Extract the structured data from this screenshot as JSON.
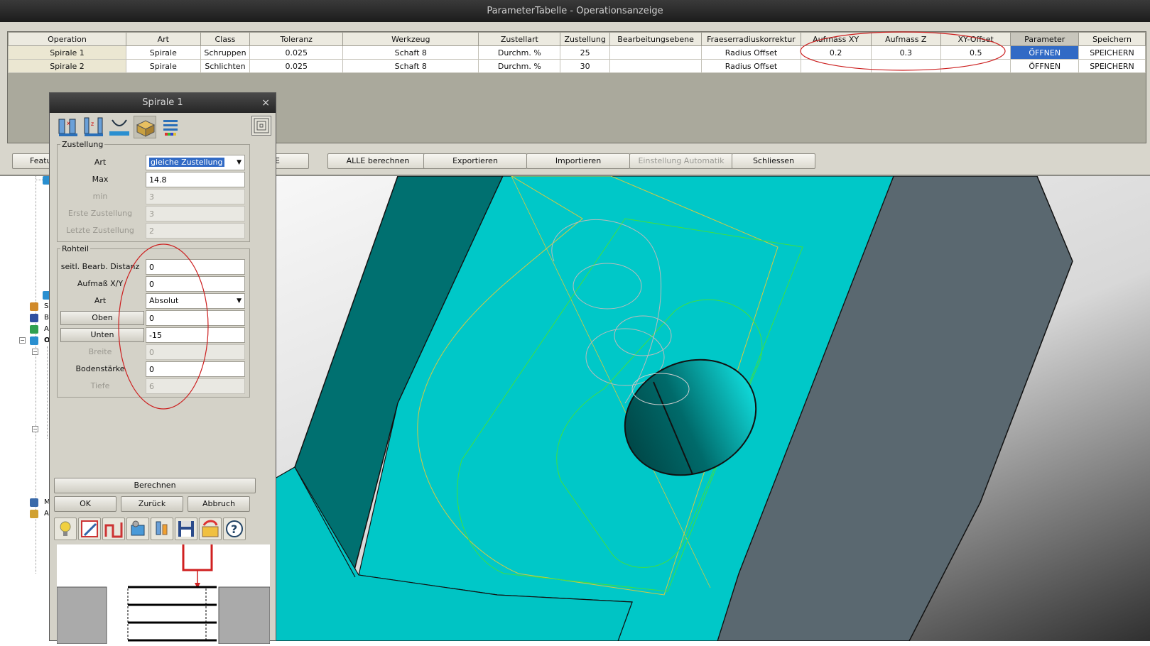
{
  "param_window": {
    "title": "ParameterTabelle - Operationsanzeige",
    "columns": [
      "Operation",
      "Art",
      "Class",
      "Toleranz",
      "Werkzeug",
      "Zustellart",
      "Zustellung",
      "Bearbeitungsebene",
      "Fraeserradiuskorrektur",
      "Aufmass XY",
      "Aufmass Z",
      "XY-Offset",
      "Parameter",
      "Speichern"
    ],
    "rows": [
      [
        "Spirale 1",
        "Spirale",
        "Schruppen",
        "0.025",
        "Schaft 8",
        "Durchm. %",
        "25",
        "",
        "Radius Offset",
        "0.2",
        "0.3",
        "0.5",
        "ÖFFNEN",
        "SPEICHERN"
      ],
      [
        "Spirale 2",
        "Spirale",
        "Schlichten",
        "0.025",
        "Schaft 8",
        "Durchm. %",
        "30",
        "",
        "Radius Offset",
        "",
        "",
        "",
        "ÖFFNEN",
        "SPEICHERN"
      ]
    ],
    "buttons": {
      "features": "Featu",
      "alle": "ALLE",
      "alle_berechnen": "ALLE berechnen",
      "exportieren": "Exportieren",
      "importieren": "Importieren",
      "einstellung_automatik": "Einstellung Automatik",
      "schliessen": "Schliessen"
    }
  },
  "dialog": {
    "title": "Spirale 1",
    "close": "×",
    "zustellung": {
      "legend": "Zustellung",
      "art_label": "Art",
      "art_value": "gleiche Zustellung",
      "max_label": "Max",
      "max_value": "14.8",
      "min_label": "min",
      "min_value": "3",
      "erste_label": "Erste Zustellung",
      "erste_value": "3",
      "letzte_label": "Letzte Zustellung",
      "letzte_value": "2"
    },
    "rohteil": {
      "legend": "Rohteil",
      "seitl_label": "seitl. Bearb. Distanz",
      "seitl_value": "0",
      "aufmass_label": "Aufmaß X/Y",
      "aufmass_value": "0",
      "art_label": "Art",
      "art_value": "Absolut",
      "oben_label": "Oben",
      "oben_value": "0",
      "unten_label": "Unten",
      "unten_value": "-15",
      "breite_label": "Breite",
      "breite_value": "0",
      "boden_label": "Bodenstärke",
      "boden_value": "0",
      "tiefe_label": "Tiefe",
      "tiefe_value": "6"
    },
    "buttons": {
      "berechnen": "Berechnen",
      "ok": "OK",
      "zurueck": "Zurück",
      "abbruch": "Abbruch"
    }
  },
  "tree": {
    "labels": [
      "S",
      "B",
      "A",
      "O",
      "M",
      "A"
    ]
  },
  "colors": {
    "cyan_face": "#00c8c8",
    "dark_teal": "#006e6e",
    "slate": "#5a6870",
    "selection_blue": "#316ac5",
    "annotation_red": "#cc1f1f"
  }
}
